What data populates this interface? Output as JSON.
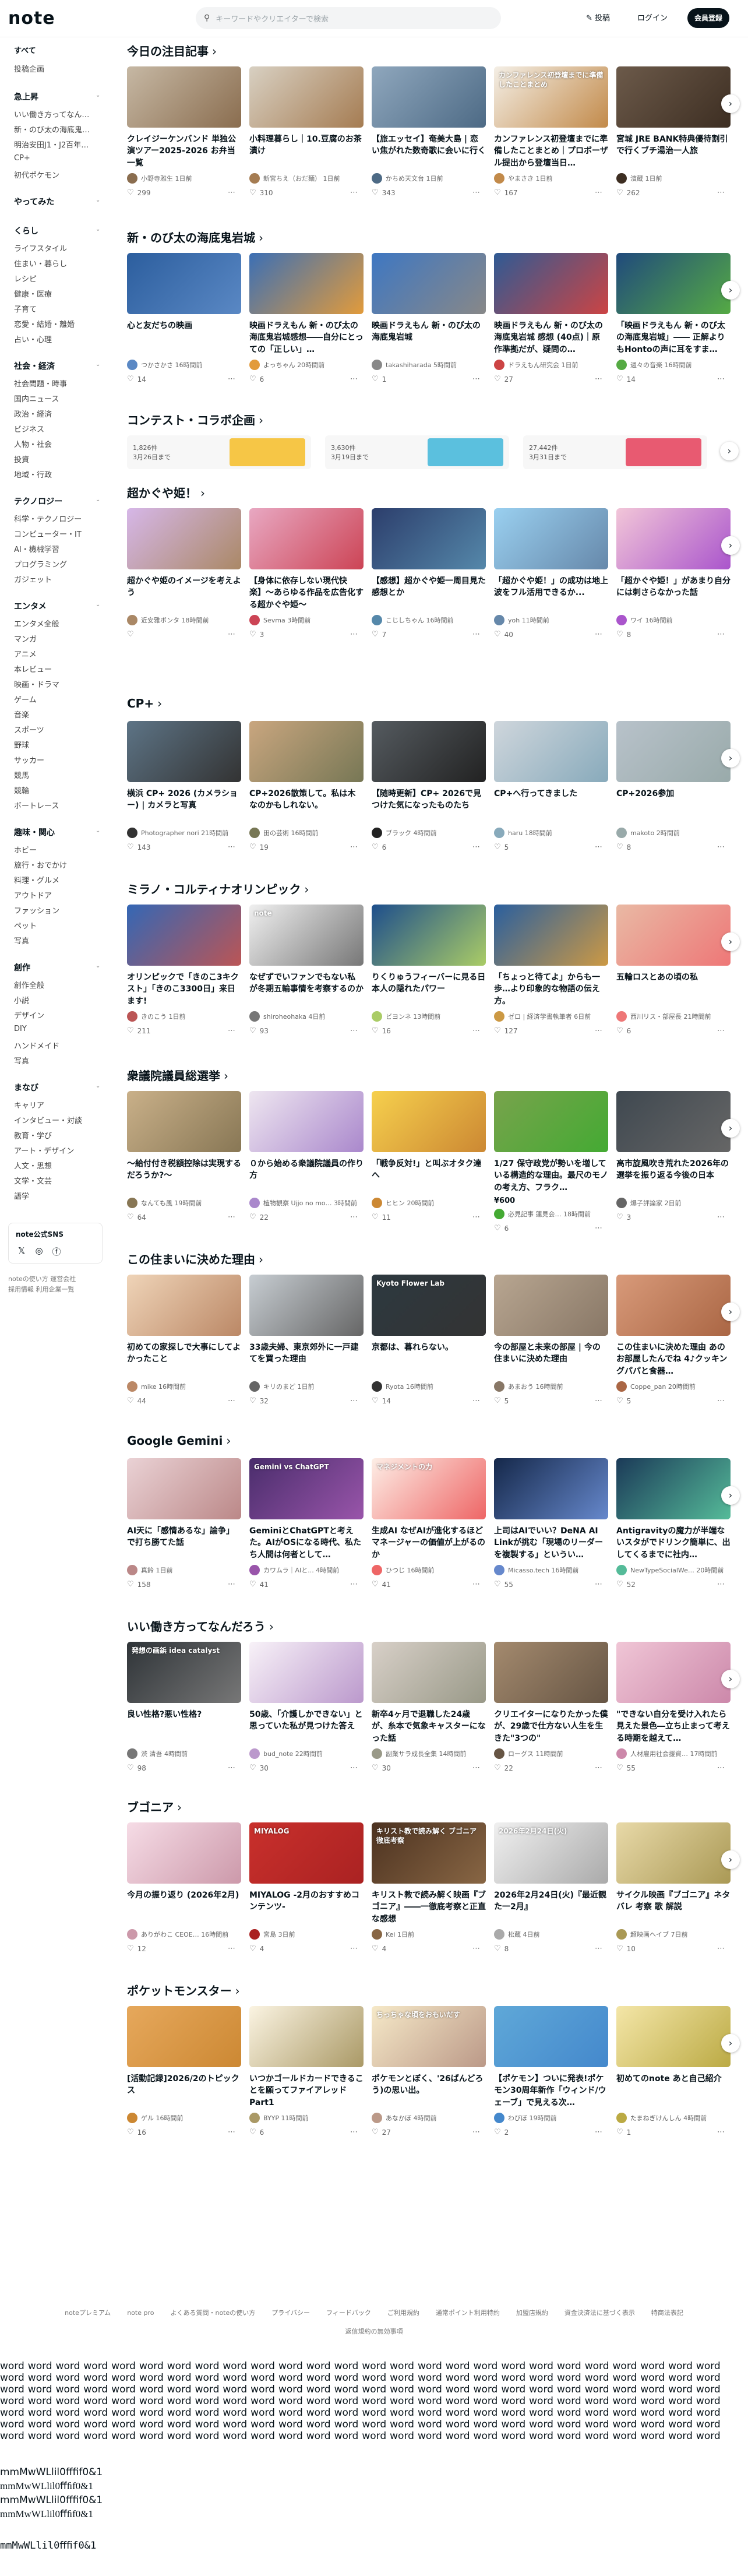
{
  "header": {
    "logo": "note",
    "search_placeholder": "キーワードやクリエイターで検索",
    "post": "投稿",
    "login": "ログイン",
    "register": "会員登録"
  },
  "sidebar": {
    "top": [
      "すべて",
      "投稿企画"
    ],
    "groups": [
      {
        "head": "急上昇",
        "items": [
          "いい働き方ってなん…",
          "新・のび太の海底鬼…",
          "明治安田J1・J2百年…",
          "CP+",
          "初代ポケモン"
        ]
      },
      {
        "head": "やってみた",
        "items": []
      },
      {
        "head": "くらし",
        "items": [
          "ライフスタイル",
          "住まい・暮らし",
          "レシピ",
          "健康・医療",
          "子育て",
          "恋愛・結婚・離婚",
          "占い・心理"
        ]
      },
      {
        "head": "社会・経済",
        "items": [
          "社会問題・時事",
          "国内ニュース",
          "政治・経済",
          "ビジネス",
          "人物・社会",
          "投資",
          "地域・行政"
        ]
      },
      {
        "head": "テクノロジー",
        "items": [
          "科学・テクノロジー",
          "コンピューター・IT",
          "AI・機械学習",
          "プログラミング",
          "ガジェット"
        ]
      },
      {
        "head": "エンタメ",
        "items": [
          "エンタメ全般",
          "マンガ",
          "アニメ",
          "本レビュー",
          "映画・ドラマ",
          "ゲーム",
          "音楽",
          "スポーツ",
          "野球",
          "サッカー",
          "競馬",
          "競輪",
          "ボートレース"
        ]
      },
      {
        "head": "趣味・関心",
        "items": [
          "ホビー",
          "旅行・おでかけ",
          "料理・グルメ",
          "アウトドア",
          "ファッション",
          "ペット",
          "写真"
        ]
      },
      {
        "head": "創作",
        "items": [
          "創作全般",
          "小説",
          "デザイン",
          "DIY",
          "ハンドメイド",
          "写真"
        ]
      },
      {
        "head": "まなび",
        "items": [
          "キャリア",
          "インタビュー・対談",
          "教育・学び",
          "アート・デザイン",
          "人文・思想",
          "文学・文芸",
          "語学"
        ]
      }
    ],
    "sns_title": "note公式SNS",
    "foot1": "noteの使い方 運営会社",
    "foot2": "採用情報 利用企業一覧"
  },
  "sections": [
    {
      "title": "今日の注目記事",
      "cards": [
        {
          "title": "クレイジーケンバンド 単独公演ツアー2025-2026 お弁当一覧",
          "author": "小野寺雅生 1日前",
          "likes": "299",
          "thumb": "#c6b8a4",
          "dot": "#8a6d4f"
        },
        {
          "title": "小料理暮らし｜10.豆腐のお茶漬け",
          "author": "新宮ちえ（おだ麺） 1日前",
          "likes": "310",
          "thumb": "#d8d0c2",
          "dot": "#a57c52"
        },
        {
          "title": "【旅エッセイ】奄美大島 | 恋い焦がれた数奇歌に会いに行く",
          "author": "かちめ天文台 1日前",
          "likes": "343",
          "thumb": "#8fa7bd",
          "dot": "#4d6a85"
        },
        {
          "title": "カンファレンス初登壇までに準備したことまとめ｜プロボーザル提出から登壇当日…",
          "author": "やまさき 1日前",
          "likes": "167",
          "thumb": "#f4efe6",
          "dot": "#c28a4a",
          "ttext": "カンファレンス初登壇までに準備したことまとめ"
        },
        {
          "title": "宮城 JRE BANK特典優待割引で行くブチ湯治一人旅",
          "author": "濱蔵 1日前",
          "likes": "262",
          "thumb": "#6c5a4a",
          "dot": "#3d2e22"
        }
      ]
    },
    {
      "title": "新・のび太の海底鬼岩城",
      "cards": [
        {
          "title": "心と友だちの映画",
          "author": "つかさかさ 16時間前",
          "likes": "14",
          "thumb": "#2c5e9e",
          "dot": "#5a88c4"
        },
        {
          "title": "映画ドラえもん 新・のび太の海底鬼岩城感想――自分にとっての「正しい」…",
          "author": "よっちゃん 20時間前",
          "likes": "6",
          "thumb": "#3b6fb5",
          "dot": "#e29b3b"
        },
        {
          "title": "映画ドラえもん 新・のび太の海底鬼岩城",
          "author": "takashiharada 5時間前",
          "likes": "1",
          "thumb": "#3e77c2",
          "dot": "#888"
        },
        {
          "title": "映画ドラえもん 新・のび太の海底鬼岩城 感想 (40点)｜原作準拠だが、疑問の…",
          "author": "ドラえもん研究会 1日前",
          "likes": "27",
          "thumb": "#2f5a94",
          "dot": "#c44"
        },
        {
          "title": "「映画ドラえもん 新・のび太の海底鬼岩城」―― 正解よりもHontoの声に耳をすま…",
          "author": "週々の音楽 16時間前",
          "likes": "14",
          "thumb": "#204a7c",
          "dot": "#5a4"
        }
      ]
    },
    {
      "title": "コンテスト・コラボ企画",
      "contests": [
        {
          "count": "1,826件",
          "date": "3月26日まで",
          "img": "#f6c646"
        },
        {
          "count": "3,630件",
          "date": "3月19日まで",
          "img": "#5bc0de"
        },
        {
          "count": "27,442件",
          "date": "3月31日まで",
          "img": "#e85a71"
        }
      ]
    },
    {
      "title": "超かぐや姫！",
      "cards": [
        {
          "title": "超かぐや姫のイメージを考えよう",
          "author": "近安雅ボンタ 18時間前",
          "likes": "",
          "thumb": "#d6b7e8",
          "dot": "#a86"
        },
        {
          "title": "【身体に依存しない現代快楽】〜あらゆる作品を広告化する超かぐや姫〜",
          "author": "Sevma 3時間前",
          "likes": "3",
          "thumb": "#e8a8c2",
          "dot": "#c45"
        },
        {
          "title": "【感想】超かぐや姫一周目見た感想とか",
          "author": "こじしちゃん 16時間前",
          "likes": "7",
          "thumb": "#2c3e6c",
          "dot": "#58a"
        },
        {
          "title": "「超かぐや姫！」の成功は地上波をフル活用できるか...",
          "author": "yoh 11時間前",
          "likes": "40",
          "thumb": "#9ad0f0",
          "dot": "#68a"
        },
        {
          "title": "「超かぐや姫！」があまり自分には刺さらなかった話",
          "author": "ワイ 16時間前",
          "likes": "8",
          "thumb": "#f2c6d8",
          "dot": "#a5c"
        }
      ]
    },
    {
      "title": "CP+",
      "cards": [
        {
          "title": "横浜 CP+ 2026 (カメラショー) | カメラと写真",
          "author": "Photographer nori 21時間前",
          "likes": "143",
          "thumb": "#5d7486",
          "dot": "#333"
        },
        {
          "title": "CP+2026散策して。私は木なのかもしれない。",
          "author": "田の芸術 16時間前",
          "likes": "19",
          "thumb": "#c9a67f",
          "dot": "#775"
        },
        {
          "title": "【随時更新】CP+ 2026で見つけた気になったものたち",
          "author": "ブラック 4時間前",
          "likes": "6",
          "thumb": "#555b60",
          "dot": "#222"
        },
        {
          "title": "CP+へ行ってきました",
          "author": "haru 18時間前",
          "likes": "5",
          "thumb": "#cfd6dc",
          "dot": "#8ab"
        },
        {
          "title": "CP+2026参加",
          "author": "makoto 2時間前",
          "likes": "8",
          "thumb": "#b8c2ca",
          "dot": "#9aa"
        }
      ]
    },
    {
      "title": "ミラノ・コルティナオリンピック",
      "cards": [
        {
          "title": "オリンピックで「きのこ3キクスト」「きのこ3300日」来日ます!",
          "author": "きのこう 1日前",
          "likes": "211",
          "thumb": "#3467b5",
          "dot": "#b55"
        },
        {
          "title": "なぜずでいファンでもない私が冬期五輪事情を考察するのか",
          "author": "shiroheohaka 4日前",
          "likes": "93",
          "thumb": "#f0f0f0",
          "dot": "#777",
          "ttext": "note"
        },
        {
          "title": "りくりゅうフィーバーに見る日本人の隠れたパワー",
          "author": "ビヨンネ 13時間前",
          "likes": "16",
          "thumb": "#1d4e8c",
          "dot": "#ac6"
        },
        {
          "title": "「ちょっと待てよ」からも一歩…より印象的な物語の伝え方。",
          "author": "ゼロ | 経済学書執筆者 6日前",
          "likes": "127",
          "thumb": "#2a5f9e",
          "dot": "#c94"
        },
        {
          "title": "五輪ロスとあの頃の私",
          "author": "西川リス・部屋長 21時間前",
          "likes": "6",
          "thumb": "#e9b9a4",
          "dot": "#e77"
        }
      ]
    },
    {
      "title": "衆議院議員総選挙",
      "cards": [
        {
          "title": "〜給付付き税額控除は実現するだろうか?〜",
          "author": "なんても風 19時間前",
          "likes": "64",
          "thumb": "#c9b089",
          "dot": "#875"
        },
        {
          "title": "０から始める衆議院議員の作り方",
          "author": "植物観察 Ujjo no mo… 3時間前",
          "likes": "22",
          "thumb": "#eee6f0",
          "dot": "#a8c"
        },
        {
          "title": "「戦争反対!」と叫ぶオタク達へ",
          "author": "ヒヒン 20時間前",
          "likes": "11",
          "thumb": "#f6d04d",
          "dot": "#c83"
        },
        {
          "title": "1/27 保守政党が勢いを増している構造的な理由。最尺のモノの考え方、フラク…",
          "author": "必見記事 蓮見会… 18時間前",
          "likes": "6",
          "thumb": "#78a34c",
          "dot": "#4a3",
          "price": "¥600"
        },
        {
          "title": "高市旋風吹き荒れた2026年の選挙を振り返る今後の日本",
          "author": "爆子評論家 2日前",
          "likes": "3",
          "thumb": "#3f4850",
          "dot": "#666"
        }
      ]
    },
    {
      "title": "この住まいに決めた理由",
      "cards": [
        {
          "title": "初めての家探しで大事にしてよかったこと",
          "author": "mike 16時間前",
          "likes": "44",
          "thumb": "#efd4b8",
          "dot": "#b86"
        },
        {
          "title": "33歳夫婦、東京郊外に一戸建てを買った理由",
          "author": "キリのまど 1日前",
          "likes": "32",
          "thumb": "#c7cdd2",
          "dot": "#666"
        },
        {
          "title": "京都は、暮れらない。",
          "author": "Ryota 16時間前",
          "likes": "14",
          "thumb": "#2d3940",
          "dot": "#333",
          "ttext": "Kyoto Flower Lab"
        },
        {
          "title": "今の部屋と未来の部屋 | 今の住まいに決めた理由",
          "author": "あまおう 16時間前",
          "likes": "5",
          "thumb": "#b8a691",
          "dot": "#876"
        },
        {
          "title": "この住まいに決めた理由 あのお部屋したんでね 4♪クッキングパパと食器…",
          "author": "Coppe_pan 20時間前",
          "likes": "5",
          "thumb": "#d89a7a",
          "dot": "#a64"
        }
      ]
    },
    {
      "title": "Google Gemini",
      "cards": [
        {
          "title": "AI天に「感情あるな」論争」で打ち勝てた話",
          "author": "真鈴 1日前",
          "likes": "158",
          "thumb": "#ead2d5",
          "dot": "#b88"
        },
        {
          "title": "GeminiとChatGPTと考えた。AIがOSになる時代、私たち人間は何者として…",
          "author": "カワムラ｜AIと... 4時間前",
          "likes": "41",
          "thumb": "#4a2d6c",
          "dot": "#95a",
          "ttext": "Gemini vs ChatGPT"
        },
        {
          "title": "生成AI なぜAIが進化するほどマネージャーの価値が上がるのか",
          "author": "ひつじ 16時間前",
          "likes": "41",
          "thumb": "#fdeee6",
          "dot": "#e66",
          "ttext": "マネジメントの力"
        },
        {
          "title": "上司はAIでいい？DeNA AI Linkが挑む「現場のリーダーを複製する」というい…",
          "author": "Micasso.tech 16時間前",
          "likes": "55",
          "thumb": "#15284a",
          "dot": "#68c"
        },
        {
          "title": "Antigravityの魔力が半端ないスタがでドリンク簡単に、出してくるまでに社内…",
          "author": "NewTypeSocialWe… 20時間前",
          "likes": "52",
          "thumb": "#1b3a58",
          "dot": "#5b9"
        }
      ]
    },
    {
      "title": "いい働き方ってなんだろう",
      "cards": [
        {
          "title": "良い性格?悪い性格?",
          "author": "渋 清吾 4時間前",
          "likes": "98",
          "thumb": "#2f3438",
          "dot": "#777",
          "ttext": "発想の画鋲 idea catalyst"
        },
        {
          "title": "50歳、「介護しかできない」と思っていた私が見つけた答え",
          "author": "bud_note 22時間前",
          "likes": "30",
          "thumb": "#f8f2f8",
          "dot": "#b9c"
        },
        {
          "title": "新卒4ヶ月で退職した24歳が、糸本で気象キャスターになった話",
          "author": "副業サラ成長全集 14時間前",
          "likes": "30",
          "thumb": "#d8d0c8",
          "dot": "#998"
        },
        {
          "title": "クリエイターになりたかった僕が、29歳で仕方ない人生を生きた\"3つの\"",
          "author": "ローグス 11時間前",
          "likes": "22",
          "thumb": "#a48a6e",
          "dot": "#654"
        },
        {
          "title": "\"できない自分を受け入れたら見えた景色―立ち止まって考える時期を越えて…",
          "author": "人材雇用社会援資… 17時間前",
          "likes": "55",
          "thumb": "#f0c6d6",
          "dot": "#c8a"
        }
      ]
    },
    {
      "title": "ブゴニア",
      "cards": [
        {
          "title": "今月の振り返り (2026年2月)",
          "author": "ありがわこ CEOE… 16時間前",
          "likes": "12",
          "thumb": "#f6dce6",
          "dot": "#c9a"
        },
        {
          "title": "MIYALOG -2月のおすすめコンテンツ-",
          "author": "宮島 3日前",
          "likes": "4",
          "thumb": "#c9302c",
          "dot": "#a22",
          "ttext": "MIYALOG"
        },
        {
          "title": "キリスト教で読み解く映画『ブゴニア』――一徹底考察と正直な感想",
          "author": "Kei 1日前",
          "likes": "4",
          "thumb": "#4c3220",
          "dot": "#864",
          "ttext": "キリスト教で読み解く ブゴニア 徹底考察"
        },
        {
          "title": "2026年2月24日(火)『最近観た一2月』",
          "author": "松蔵 4日前",
          "likes": "8",
          "thumb": "#f0f0f0",
          "dot": "#aaa",
          "ttext": "2026年2月24日(火)"
        },
        {
          "title": "サイクル映画『ブゴニア』ネタバレ 考察 歌 解説",
          "author": "超映画ヘイブ 7日前",
          "likes": "10",
          "thumb": "#e8d9a8",
          "dot": "#a95"
        }
      ]
    },
    {
      "title": "ポケットモンスター",
      "cards": [
        {
          "title": "[活動記録]2026/2のトピックス",
          "author": "ゲル 16時間前",
          "likes": "16",
          "thumb": "#e6a85c",
          "dot": "#c83"
        },
        {
          "title": "いつかゴールドカードできることを願ってファイアレッドPart1",
          "author": "BYYP 11時間前",
          "likes": "6",
          "thumb": "#fbf4e2",
          "dot": "#a96"
        },
        {
          "title": "ポケモンとぼく、'26ばんどろう)の思い出。",
          "author": "あなかぼ 4時間前",
          "likes": "27",
          "thumb": "#f6e9c8",
          "dot": "#b98",
          "ttext": "ちっちゃな頃をおもいだす"
        },
        {
          "title": "【ポケモン】ついに発表!ポケモン30周年新作「ウィンド/ウェーブ」で見える次…",
          "author": "わびぼ 19時間前",
          "likes": "2",
          "thumb": "#5fa8d8",
          "dot": "#48c"
        },
        {
          "title": "初めてのnote あと自己紹介",
          "author": "たまねぎけんしん 4時間前",
          "likes": "1",
          "thumb": "#f4e6a8",
          "dot": "#ba4"
        }
      ]
    }
  ],
  "footer": {
    "links": [
      "noteプレミアム",
      "note pro",
      "よくある質問・noteの使い方",
      "プライバシー",
      "フィードバック",
      "ご利用規約",
      "通常ポイント利用特約",
      "加盟店規約",
      "資金決済法に基づく表示",
      "特商法表記"
    ],
    "sub": "返信規約の無効事項"
  },
  "filler": {
    "word": "word",
    "mono": [
      "mmMwWLlil0ﬀﬁf0&1",
      "mmMwWLlil0ﬀﬁf0&1",
      "mmMwWLlil0ﬀﬁf0&1",
      "mmMwWLlil0ﬀﬁf0&1",
      "mmMwWLlil0ﬀﬁf0&1"
    ]
  }
}
